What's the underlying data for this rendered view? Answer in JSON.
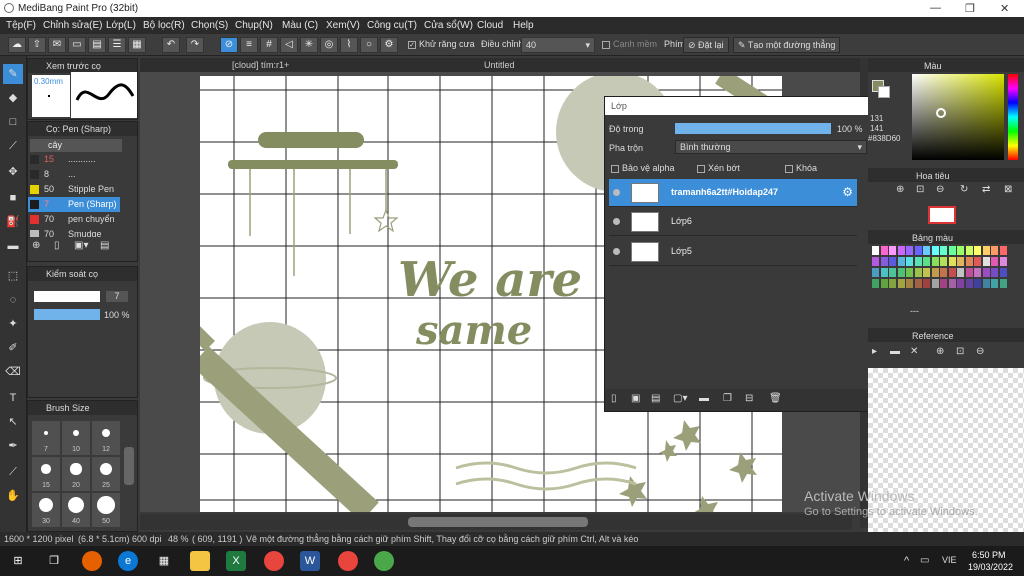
{
  "window": {
    "title": "MediBang Paint Pro (32bit)",
    "min": "—",
    "max": "❐",
    "close": "✕"
  },
  "menu": [
    "Tệp(F)",
    "Chỉnh sửa(E)",
    "Lớp(L)",
    "Bộ lọc(R)",
    "Chọn(S)",
    "Chụp(N)",
    "Màu (C)",
    "Xem(V)",
    "Công cụ(T)",
    "Cửa sổ(W)",
    "Cloud",
    "Help"
  ],
  "toolbar": {
    "antialias": "Khử răng cưa",
    "adjust_label": "Điều chỉnh",
    "adjust_value": "40",
    "edge": "Cạnh mềm",
    "key_label": "Phím",
    "reset": "Đặt lại",
    "straight": "Tạo một đường thẳng"
  },
  "preview": {
    "title": "Xem trước cọ",
    "size": "0.30mm"
  },
  "brushpanel": {
    "title": "Cọ: Pen (Sharp)",
    "group": "cây",
    "rows": [
      {
        "size": "15",
        "name": "...........",
        "color": "#2a2a2a"
      },
      {
        "size": "8",
        "name": "...",
        "color": "#2a2a2a"
      },
      {
        "size": "50",
        "name": "Stipple Pen",
        "color": "#e6d400"
      },
      {
        "size": "7",
        "name": "Pen (Sharp)",
        "color": "#1c1c1c"
      },
      {
        "size": "70",
        "name": "pen chuyển",
        "color": "#e03030"
      },
      {
        "size": "70",
        "name": "Smudge",
        "color": "#bbbbbb"
      }
    ]
  },
  "control": {
    "title": "Kiểm soát cọ",
    "size": "7",
    "opacity": "100 %",
    "opacity_level": 1.0
  },
  "brushsize": {
    "title": "Brush Size",
    "labels": [
      "7",
      "10",
      "12",
      "15",
      "20",
      "25",
      "30",
      "40",
      "50"
    ]
  },
  "tabs": [
    "[cloud] tím:r1+",
    "Untitled"
  ],
  "canvas_text": {
    "line1": "We are",
    "line2": "same"
  },
  "layers": {
    "title": "Lớp",
    "opacity_label": "Độ trong",
    "opacity_value": "100 %",
    "opacity_level": 1.0,
    "blend_label": "Pha trộn",
    "blend_value": "Bình thường",
    "protect": "Bảo vệ alpha",
    "clip": "Xén bớt",
    "lock": "Khóa",
    "items": [
      {
        "name": "tramanh6a2tt#Hoidap247",
        "selected": true
      },
      {
        "name": "Lớp6",
        "selected": false
      },
      {
        "name": "Lớp5",
        "selected": false
      }
    ]
  },
  "colorpanel": {
    "title": "Màu",
    "hex": "#838D60",
    "r": "131",
    "g": "141"
  },
  "navigator": {
    "title": "Hoa tiêu"
  },
  "palette": {
    "title": "Bảng màu",
    "extra": "---"
  },
  "reference": {
    "title": "Reference"
  },
  "status": {
    "size": "1600 * 1200 pixel",
    "cm": "(6.8 * 5.1cm)",
    "dpi": "600 dpi",
    "zoom": "48 %",
    "coord": "( 609, 1191 )",
    "hint": "Vẽ một đường thẳng bằng cách giữ phím Shift, Thay đổi cỡ cọ bằng cách giữ phím Ctrl, Alt và kéo"
  },
  "taskbar": {
    "time": "6:50 PM",
    "date": "19/03/2022",
    "lang": "VIE"
  },
  "watermark": {
    "line1": "Activate Windows",
    "line2": "Go to Settings to activate Windows."
  }
}
